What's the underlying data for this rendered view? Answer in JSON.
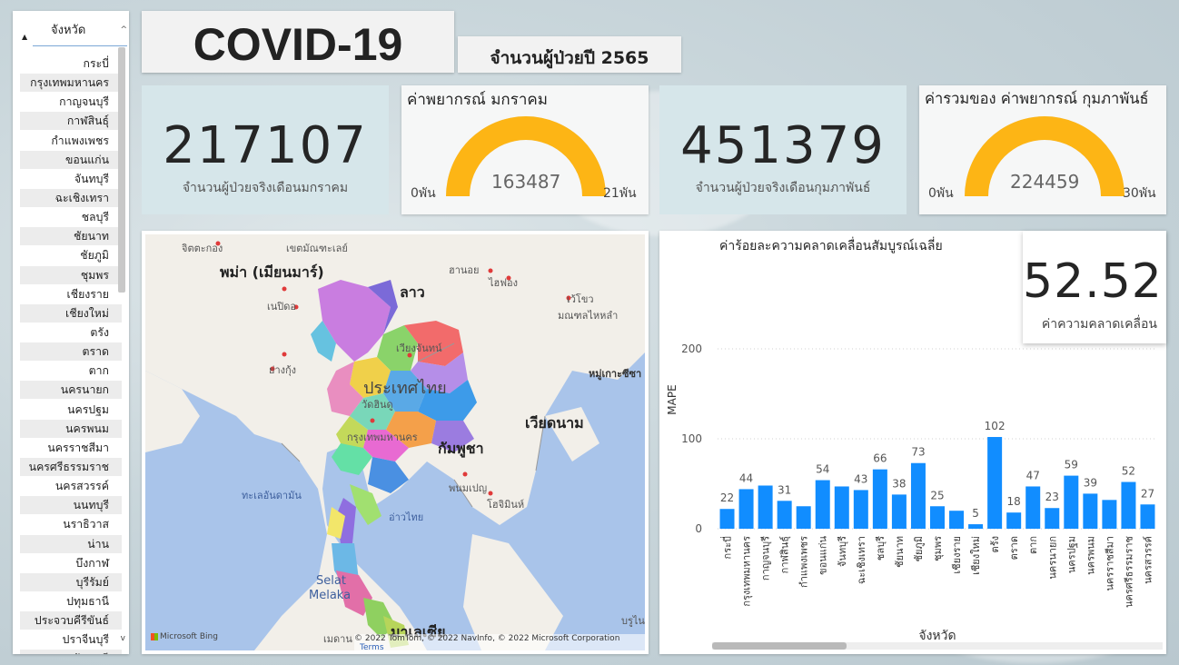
{
  "slicer": {
    "title": "จังหวัด",
    "items": [
      "กระบี่",
      "กรุงเทพมหานคร",
      "กาญจนบุรี",
      "กาฬสินธุ์",
      "กำแพงเพชร",
      "ขอนแก่น",
      "จันทบุรี",
      "ฉะเชิงเทรา",
      "ชลบุรี",
      "ชัยนาท",
      "ชัยภูมิ",
      "ชุมพร",
      "เชียงราย",
      "เชียงใหม่",
      "ตรัง",
      "ตราด",
      "ตาก",
      "นครนายก",
      "นครปฐม",
      "นครพนม",
      "นครราชสีมา",
      "นครศรีธรรมราช",
      "นครสวรรค์",
      "นนทบุรี",
      "นราธิวาส",
      "น่าน",
      "บึงกาฬ",
      "บุรีรัมย์",
      "ปทุมธานี",
      "ประจวบคีรีขันธ์",
      "ปราจีนบุรี",
      "ปัตตานี"
    ]
  },
  "header": {
    "title": "COVID-19",
    "subtitle": "จำนวนผู้ป่วยปี 2565"
  },
  "kpi_jan": {
    "value": "217107",
    "label": "จำนวนผู้ป่วยจริงเดือนมกราคม"
  },
  "gauge_jan": {
    "title": "ค่าพยากรณ์ มกราคม",
    "value": "163487",
    "min": "0พัน",
    "max": "21พัน",
    "fill_fraction": 1.0,
    "color": "#FDB515"
  },
  "kpi_feb": {
    "value": "451379",
    "label": "จำนวนผู้ป่วยจริงเดือนกุมภาพันธ์"
  },
  "gauge_feb": {
    "title": "ค่ารวมของ ค่าพยากรณ์ กุมภาพันธ์",
    "value": "224459",
    "min": "0พัน",
    "max": "30พัน",
    "fill_fraction": 1.0,
    "color": "#FDB515"
  },
  "map": {
    "labels": {
      "chittagong": "จิตตะกอง",
      "shwedagon": "เขตมัณฑะเลย์",
      "myanmar": "พม่า (เมียนมาร์)",
      "hanoi": "ฮานอย",
      "haiphong": "ไฮฟอง",
      "laos": "ลาว",
      "naypyidaw": "เนปิดอ",
      "hue": "เว้โขว",
      "tonkin": "มณฑลไหหลำ",
      "vientiane": "เวียงจันทน์",
      "yangon": "ย่างกุ้ง",
      "paracel": "หมู่เกาะซีซา",
      "thailand": "ประเทศไทย",
      "vietnam": "เวียดนาม",
      "bangkok": "กรุงเทพมหานคร",
      "cambodia": "กัมพูชา",
      "phnompenh": "พนมเปญ",
      "hcmc": "โฮจิมินห์",
      "andaman": "ทะเลอันดามัน",
      "gulf": "อ่าวไทย",
      "selat": "Selat",
      "melaka": "Melaka",
      "malaysia": "มาเลเซีย",
      "medan": "เมดาน",
      "brunei": "บรูไน",
      "ubon": "วัดฮินดู"
    },
    "attribution": "© 2022 TomTom, © 2022 NavInfo, © 2022 Microsoft Corporation",
    "terms": "Terms",
    "bing": "Microsoft Bing"
  },
  "mape": {
    "value": "52.52",
    "label": "ค่าความคลาดเคลื่อน"
  },
  "chart_data": {
    "type": "bar",
    "title": "ค่าร้อยละความคลาดเคลื่อนสัมบูรณ์เฉลี่ย",
    "xlabel": "จังหวัด",
    "ylabel": "MAPE",
    "ylim": [
      0,
      200
    ],
    "yticks": [
      "0",
      "100",
      "200"
    ],
    "categories": [
      "กระบี่",
      "กรุงเทพมหานคร",
      "กาญจนบุรี",
      "กาฬสินธุ์",
      "กำแพงเพชร",
      "ขอนแก่น",
      "จันทบุรี",
      "ฉะเชิงเทรา",
      "ชลบุรี",
      "ชัยนาท",
      "ชัยภูมิ",
      "ชุมพร",
      "เชียงราย",
      "เชียงใหม่",
      "ตรัง",
      "ตราด",
      "ตาก",
      "นครนายก",
      "นครปฐม",
      "นครพนม",
      "นครราชสีมา",
      "นครศรีธรรมราช",
      "นครสวรรค์"
    ],
    "values": [
      22,
      44,
      48,
      31,
      25,
      54,
      47,
      43,
      66,
      38,
      73,
      25,
      20,
      5,
      102,
      18,
      47,
      23,
      59,
      39,
      32,
      52,
      27
    ],
    "data_labels": [
      "22",
      "44",
      "",
      "31",
      "",
      "54",
      "",
      "43",
      "66",
      "38",
      "73",
      "25",
      "",
      "5",
      "102",
      "18",
      "47",
      "23",
      "59",
      "39",
      "",
      "52",
      "27"
    ],
    "bar_color": "#118DFF",
    "grid": true
  }
}
